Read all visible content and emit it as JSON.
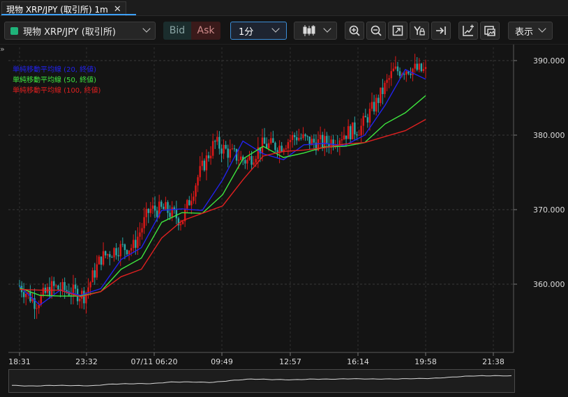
{
  "tab": {
    "title": "現物 XRP/JPY (取引所) 1m",
    "close": "✕"
  },
  "toolbar": {
    "symbol": "現物 XRP/JPY (取引所)",
    "symbol_color": "#1fb37a",
    "bid": "Bid",
    "ask": "Ask",
    "interval": "1分",
    "display": "表示",
    "icons": [
      "candlestick-icon",
      "zoom-in-icon",
      "zoom-out-icon",
      "fit-icon",
      "auto-scale-icon",
      "scroll-to-end-icon",
      "add-indicator-icon",
      "screenshot-icon"
    ]
  },
  "legend": [
    {
      "label": "単純移動平均線 (20, 終値)",
      "color": "#2222ee"
    },
    {
      "label": "単純移動平均線 (50, 終値)",
      "color": "#3ee63e"
    },
    {
      "label": "単純移動平均線 (100, 終値)",
      "color": "#e02020"
    }
  ],
  "chart_data": {
    "type": "line",
    "title": "",
    "y_ticks": [
      "390.000",
      "380.000",
      "370.000",
      "360.000"
    ],
    "x_ticks": [
      "18:31",
      "23:32",
      "07/11 06:20",
      "09:49",
      "12:57",
      "16:14",
      "19:58",
      "21:38"
    ],
    "ylim": [
      353,
      394
    ],
    "grid": true,
    "series": [
      {
        "name": "単純移動平均線 (20, 終値)",
        "color": "#2222ee",
        "x": [
          0,
          5,
          10,
          15,
          20,
          25,
          30,
          35,
          40,
          45,
          50,
          55,
          60,
          65,
          70,
          75,
          80,
          85,
          90,
          95,
          100
        ],
        "values": [
          359.7,
          357.2,
          359.2,
          358.5,
          359.4,
          363.3,
          364.9,
          369.9,
          370.1,
          369.9,
          374.0,
          379.2,
          377.5,
          376.7,
          378.7,
          378.9,
          378.6,
          380.0,
          384.0,
          388.8,
          387.5
        ]
      },
      {
        "name": "単純移動平均線 (50, 終値)",
        "color": "#3ee63e",
        "x": [
          0,
          5,
          10,
          15,
          20,
          25,
          30,
          35,
          40,
          45,
          50,
          55,
          60,
          65,
          70,
          75,
          80,
          85,
          90,
          95,
          100
        ],
        "values": [
          359.5,
          358.5,
          358.4,
          358.4,
          359.0,
          362.0,
          363.5,
          368.3,
          369.6,
          369.5,
          372.0,
          376.8,
          378.5,
          377.0,
          377.6,
          378.4,
          378.5,
          379.0,
          381.5,
          383.0,
          385.3
        ]
      },
      {
        "name": "単純移動平均線 (100, 終値)",
        "color": "#e02020",
        "x": [
          0,
          5,
          10,
          15,
          20,
          25,
          30,
          35,
          40,
          45,
          50,
          55,
          60,
          65,
          70,
          75,
          80,
          85,
          90,
          95,
          100
        ],
        "values": [
          359.3,
          359.2,
          359.2,
          358.3,
          359.0,
          361.0,
          362.0,
          366.2,
          368.5,
          369.5,
          370.5,
          374.0,
          377.2,
          377.8,
          378.0,
          378.3,
          378.8,
          379.0,
          379.8,
          380.6,
          382.1
        ]
      }
    ],
    "close_path": {
      "x": [
        0,
        4,
        8,
        12,
        16,
        20,
        24,
        28,
        32,
        36,
        40,
        44,
        48,
        52,
        56,
        60,
        64,
        68,
        72,
        76,
        80,
        84,
        88,
        92,
        96,
        100
      ],
      "values": [
        359.8,
        357.5,
        359.6,
        359.1,
        358.5,
        363.5,
        364.8,
        365.0,
        370.0,
        370.0,
        368.5,
        374.5,
        379.0,
        377.5,
        376.5,
        378.7,
        378.5,
        379.9,
        379.0,
        379.0,
        380.2,
        381.0,
        384.5,
        388.5,
        389.0,
        388.5
      ]
    }
  },
  "navigator": {
    "label": "navigator"
  }
}
